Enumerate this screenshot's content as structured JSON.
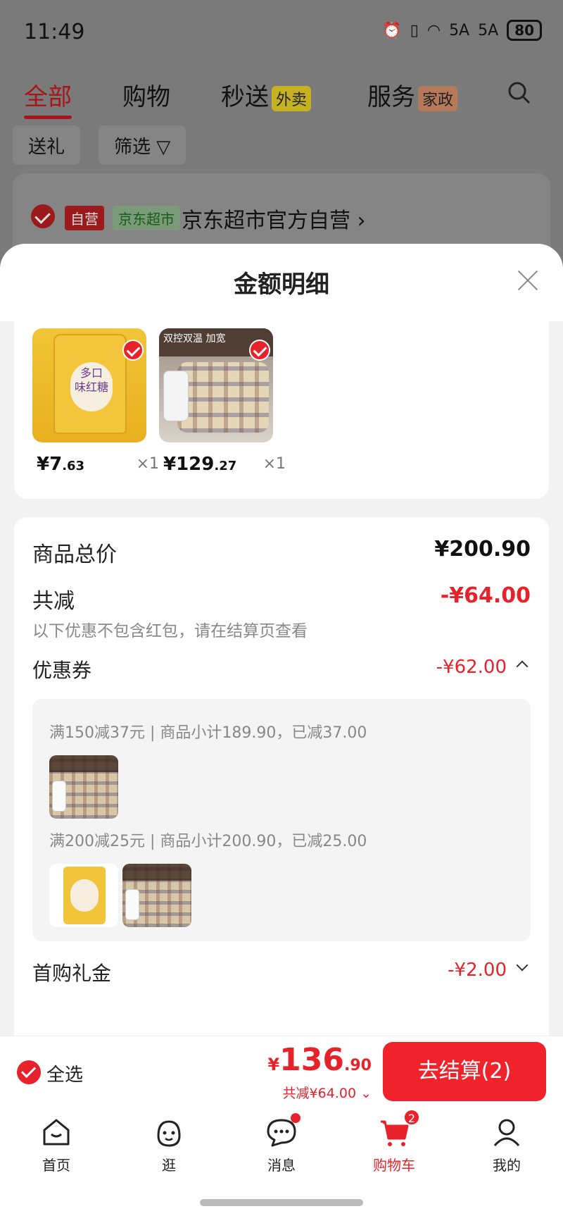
{
  "status": {
    "time": "11:49",
    "battery": "80",
    "network": "5A"
  },
  "tabs": [
    {
      "label": "全部"
    },
    {
      "label": "购物"
    },
    {
      "label": "秒送",
      "tag": "外卖"
    },
    {
      "label": "服务",
      "tag": "家政"
    }
  ],
  "filters": {
    "gift": "送礼",
    "filter": "筛选"
  },
  "store": {
    "self_tag": "自营",
    "super_tag": "京东超市",
    "name": "京东超市官方自营 ›"
  },
  "sheet": {
    "title": "金额明细"
  },
  "items": [
    {
      "name": "多口味红糖",
      "price_int": "¥7",
      "price_dec": ".63",
      "qty": "×1",
      "checked": true
    },
    {
      "name": "双控双温 加宽",
      "price_int": "¥129",
      "price_dec": ".27",
      "qty": "×1",
      "checked": true
    }
  ],
  "summary": {
    "total_label": "商品总价",
    "total_value": "¥200.90",
    "reduce_label": "共减",
    "reduce_value": "-¥64.00",
    "reduce_note": "以下优惠不包含红包，请在结算页查看",
    "coupon_label": "优惠券",
    "coupon_value": "-¥62.00",
    "coupon_lines": [
      "满150减37元 | 商品小计189.90，已减37.00",
      "满200减25元 | 商品小计200.90，已减25.00"
    ],
    "first_gift_label": "首购礼金",
    "first_gift_value": "-¥2.00"
  },
  "checkout": {
    "select_all": "全选",
    "currency": "¥",
    "total_int": "136",
    "total_dec": ".90",
    "saved": "共减¥64.00 ⌄",
    "button": "去结算(2)"
  },
  "nav": [
    {
      "label": "首页"
    },
    {
      "label": "逛"
    },
    {
      "label": "消息"
    },
    {
      "label": "购物车",
      "badge": "2"
    },
    {
      "label": "我的"
    }
  ],
  "colors": {
    "accent": "#e8222a",
    "overlay": "#7a7a7a"
  }
}
